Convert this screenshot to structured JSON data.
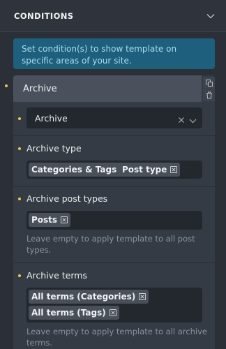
{
  "header": {
    "title": "CONDITIONS"
  },
  "info": {
    "text": "Set condition(s) to show template on specific areas of your site."
  },
  "card": {
    "title": "Archive",
    "select": {
      "value": "Archive"
    },
    "archive_type": {
      "label": "Archive type",
      "tags": [
        "Categories & Tags",
        "Post type"
      ]
    },
    "archive_post_types": {
      "label": "Archive post types",
      "tags": [
        "Posts"
      ],
      "help": "Leave empty to apply template to all post types."
    },
    "archive_terms": {
      "label": "Archive terms",
      "tags": [
        "All terms (Categories)",
        "All terms (Tags)"
      ],
      "help": "Leave empty to apply template to all archive terms."
    }
  },
  "colors": {
    "accent_dot": "#e9c84a",
    "info_bg": "#1d5f7c",
    "info_text": "#a9dcf0"
  }
}
